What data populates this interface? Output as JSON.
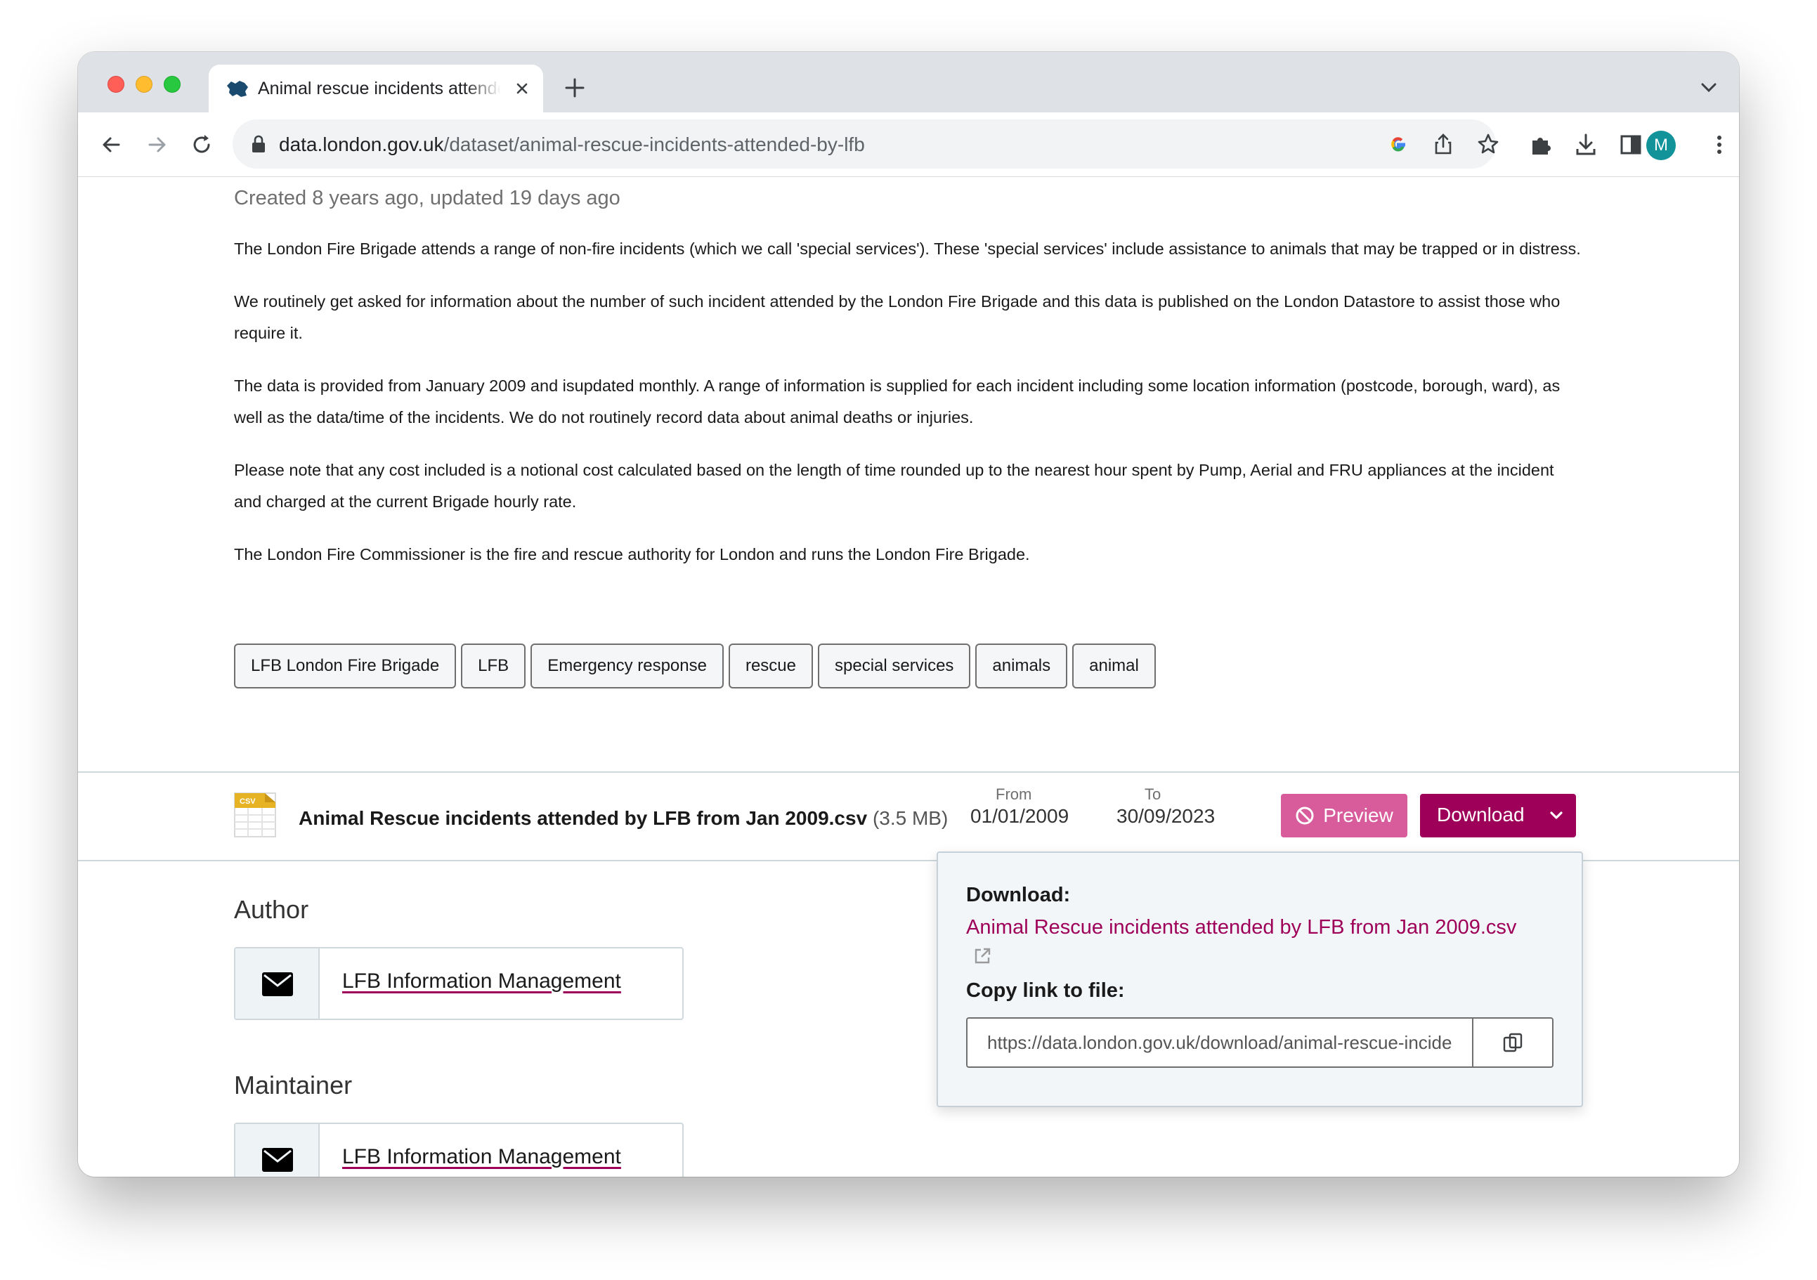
{
  "browser": {
    "tab_title": "Animal rescue incidents attended by LFB",
    "url_domain": "data.london.gov.uk",
    "url_path": "/dataset/animal-rescue-incidents-attended-by-lfb",
    "profile_initial": "M",
    "profile_color": "#12939a"
  },
  "dataset": {
    "meta": "Created 8 years ago, updated 19 days ago",
    "description": [
      "The London Fire Brigade attends a range of non-fire incidents (which we call 'special services'). These 'special services' include assistance to animals that may be trapped or in distress.",
      "We routinely get asked for information about the number of such incident attended by the London Fire Brigade and this data is published on the London Datastore to assist those who require it.",
      "The data is provided from January 2009 and isupdated monthly. A range of information is supplied for each incident including some location information (postcode, borough, ward), as well as the data/time of the incidents. We do not routinely record data about animal deaths or injuries.",
      "Please note that any cost included is a notional cost calculated based on the length of time rounded up to the nearest hour spent by Pump, Aerial and FRU appliances at the incident and charged at the current Brigade hourly rate.",
      "The London Fire Commissioner is the fire and rescue authority for London and runs the London Fire Brigade."
    ],
    "tags": [
      "LFB London Fire Brigade",
      "LFB",
      "Emergency response",
      "rescue",
      "special services",
      "animals",
      "animal"
    ]
  },
  "resource": {
    "icon_label": "CSV",
    "name": "Animal Rescue incidents attended by LFB from Jan 2009.csv",
    "size": "(3.5 MB)",
    "from_label": "From",
    "from_value": "01/01/2009",
    "to_label": "To",
    "to_value": "30/09/2023",
    "preview_label": "Preview",
    "download_label": "Download",
    "accent": "#9e0059",
    "preview_color": "#d85b9b"
  },
  "download_popover": {
    "download_heading": "Download:",
    "file_link": "Animal Rescue incidents attended by LFB from Jan 2009.csv",
    "copy_heading": "Copy link to file:",
    "copy_value": "https://data.london.gov.uk/download/animal-rescue-incidents-attended-by-lfb"
  },
  "author": {
    "heading": "Author",
    "name": "LFB Information Management"
  },
  "maintainer": {
    "heading": "Maintainer",
    "name": "LFB Information Management"
  }
}
